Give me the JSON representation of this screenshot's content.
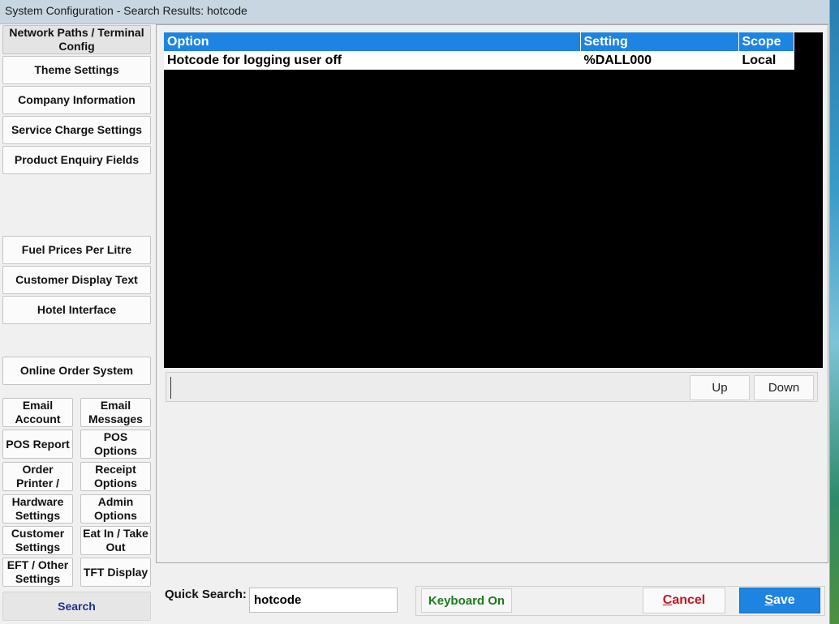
{
  "window": {
    "title": "System Configuration - Search Results: hotcode"
  },
  "sidebar": {
    "buttons": [
      "Network Paths / Terminal Config",
      "Theme Settings",
      "Company Information",
      "Service Charge Settings",
      "Product Enquiry Fields",
      "Fuel Prices Per Litre",
      "Customer Display Text",
      "Hotel Interface",
      "Online Order System"
    ],
    "pairs": [
      [
        "Email Account",
        "Email Messages"
      ],
      [
        "POS Report",
        "POS Options"
      ],
      [
        "Order Printer /",
        "Receipt Options"
      ],
      [
        "Hardware Settings",
        "Admin Options"
      ],
      [
        "Customer Settings",
        "Eat In / Take Out"
      ],
      [
        "EFT / Other Settings",
        "TFT Display"
      ]
    ],
    "search_label": "Search"
  },
  "grid": {
    "columns": [
      "Option",
      "Setting",
      "Scope"
    ],
    "rows": [
      [
        "Hotcode for logging user off",
        "%DALL000",
        "Local"
      ]
    ]
  },
  "nav": {
    "up_label": "Up",
    "down_label": "Down"
  },
  "footer": {
    "quick_search_label": "Quick Search:",
    "quick_search_value": "hotcode",
    "keyboard_label": "Keyboard On",
    "cancel_label": "Cancel",
    "save_label": "Save"
  },
  "colors": {
    "accent": "#1e84e2",
    "cancel": "#c0161f",
    "keyboard": "#1f7a1f",
    "search": "#1f2f8f"
  }
}
